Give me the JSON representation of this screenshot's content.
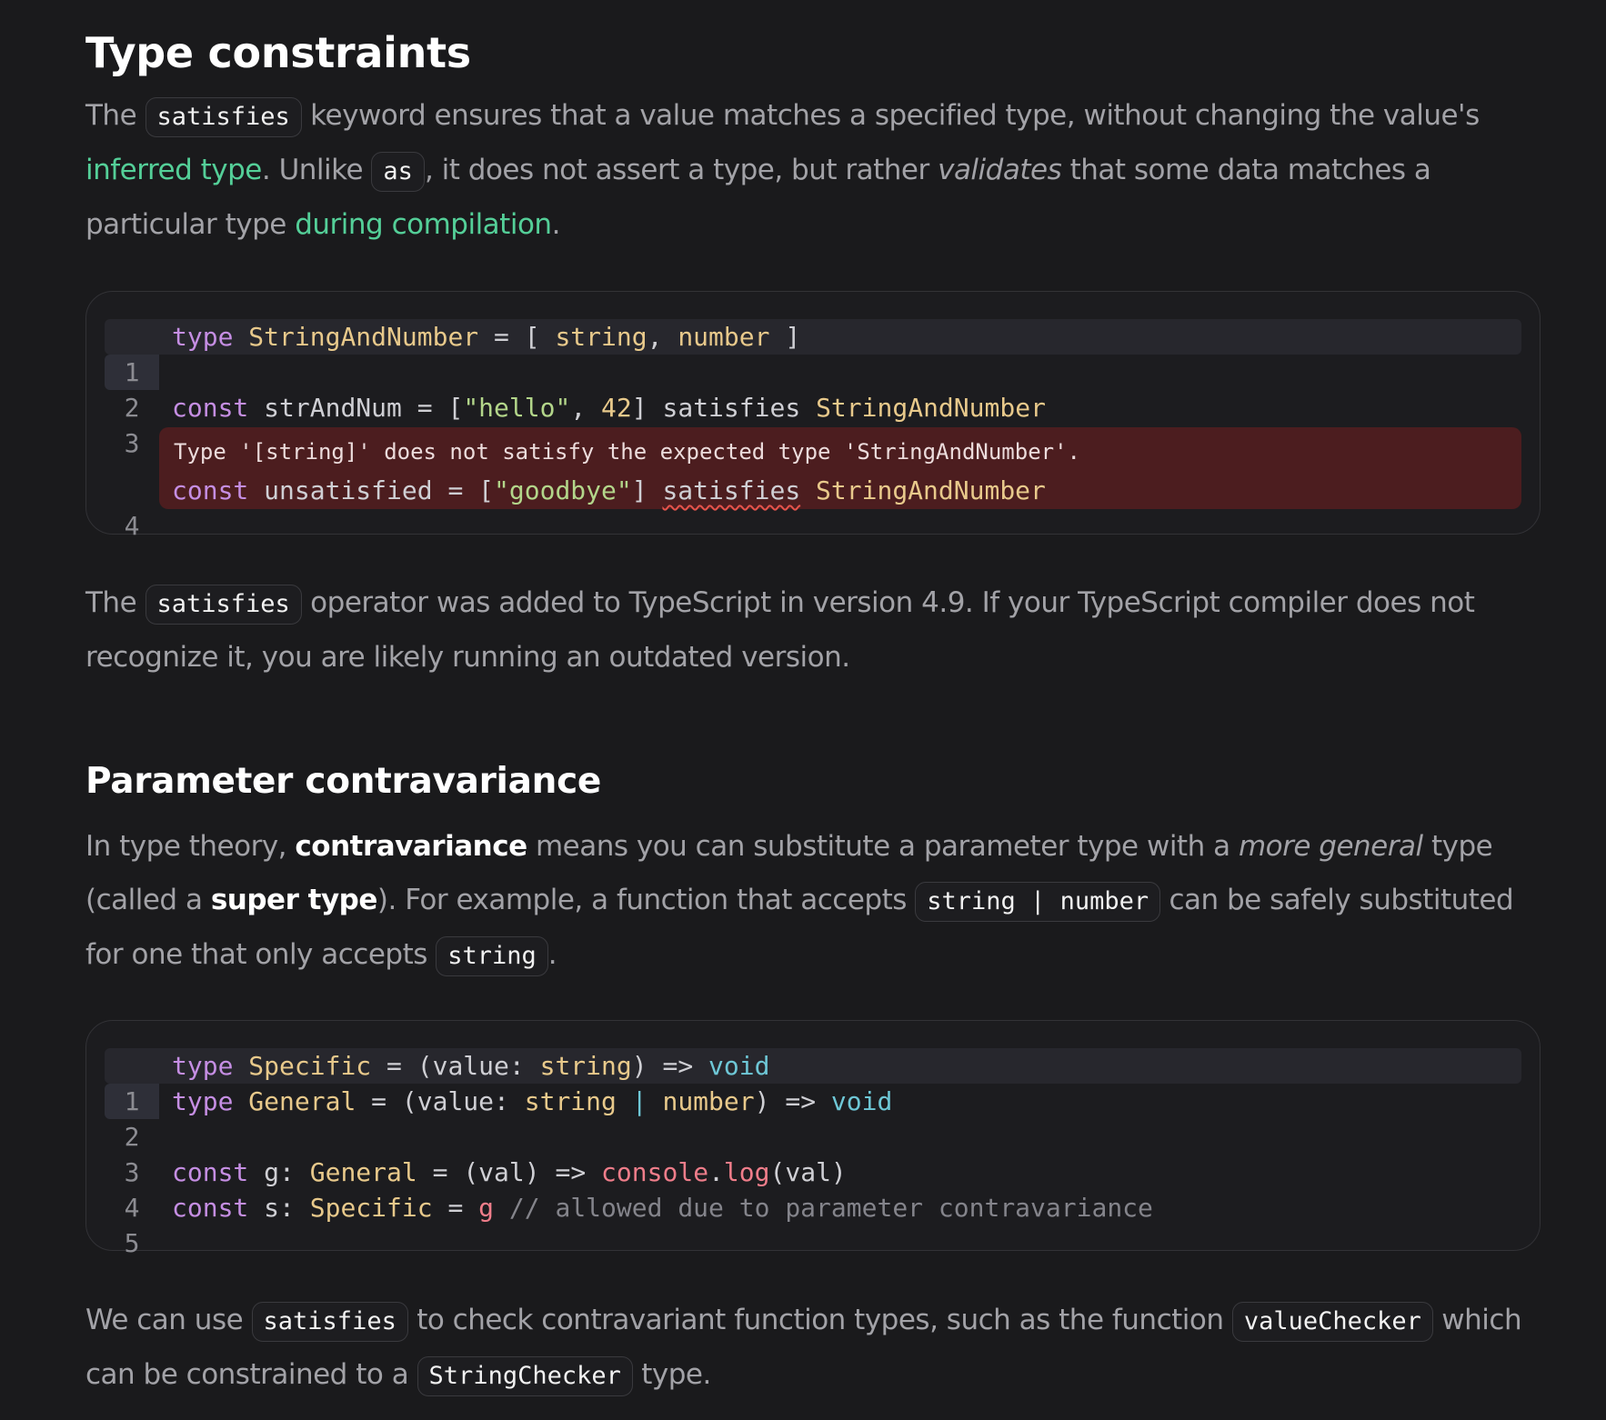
{
  "section1": {
    "heading": "Type constraints",
    "p1": {
      "t1": "The ",
      "c1": "satisfies",
      "t2": " keyword ensures that a value matches a specified type, without changing the value's ",
      "link1": "inferred type",
      "t3": ". Unlike ",
      "c2": "as",
      "t4": ", it does not assert a type, but rather ",
      "em1": "validates",
      "t5": " that some data matches a particular type ",
      "link2": "during compilation",
      "t6": "."
    },
    "code": {
      "line_numbers": [
        "1",
        "2",
        "3",
        "4"
      ],
      "l1": [
        "type",
        " StringAndNumber",
        " = [ ",
        "string",
        ", ",
        "number",
        " ]"
      ],
      "l3": [
        "const",
        " strAndNum = [",
        "\"hello\"",
        ", ",
        "42",
        "] satisfies ",
        "StringAndNumber"
      ],
      "error_message": "Type '[string]' does not satisfy the expected type 'StringAndNumber'.",
      "l4": [
        "const",
        " unsatisfied = [",
        "\"goodbye\"",
        "] ",
        "satisfies",
        " ",
        "StringAndNumber"
      ]
    },
    "p2": {
      "t1": "The ",
      "c1": "satisfies",
      "t2": " operator was added to TypeScript in version 4.9. If your TypeScript compiler does not recognize it, you are likely running an outdated version."
    }
  },
  "section2": {
    "heading": "Parameter contravariance",
    "p1": {
      "t1": "In type theory, ",
      "b1": "contravariance",
      "t2": " means you can substitute a parameter type with a ",
      "em1": "more general",
      "t3": " type (called a ",
      "b2": "super type",
      "t4": "). For example, a function that accepts ",
      "c1": "string | number",
      "t5": " can be safely substituted for one that only accepts ",
      "c2": "string",
      "t6": "."
    },
    "code": {
      "line_numbers": [
        "1",
        "2",
        "3",
        "4",
        "5"
      ],
      "l1": [
        "type",
        " Specific",
        " = (value: ",
        "string",
        ") => ",
        "void"
      ],
      "l2": [
        "type",
        " General",
        " = (value: ",
        "string",
        " | ",
        "number",
        ") => ",
        "void"
      ],
      "l4": [
        "const",
        " g: ",
        "General",
        " = (val) => ",
        "console",
        ".",
        "log",
        "(val)"
      ],
      "l5": [
        "const",
        " s: ",
        "Specific",
        " = ",
        "g",
        " // allowed due to parameter contravariance"
      ]
    },
    "p2": {
      "t1": "We can use ",
      "c1": "satisfies",
      "t2": " to check contravariant function types, such as the function ",
      "c2": "valueChecker",
      "t3": " which can be constrained to a ",
      "c3": "StringChecker",
      "t4": " type."
    }
  },
  "colors": {
    "background": "#1a1a1c",
    "link": "#54cf98",
    "keyword": "#c58ee3",
    "type": "#e8c98b",
    "string": "#b3d68a",
    "error_bg": "#4c1d1f"
  }
}
